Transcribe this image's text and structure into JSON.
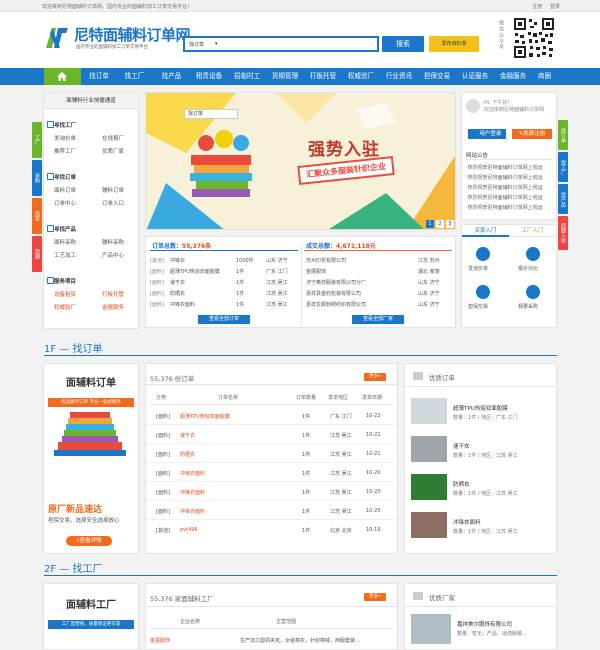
{
  "topbar": {
    "welcome": "欢迎来到尼特面辅料订单网，国内专业的面辅料加工订单交易平台！",
    "register": "注册",
    "login": "登录"
  },
  "header": {
    "logo_title": "尼特面辅料订单网",
    "logo_sub": "国内专业的面辅料加工订单交易平台",
    "search_value": "找订单",
    "search_button": "搜索",
    "publish_button": "发布询价单",
    "wechat_label": "微信公众号"
  },
  "nav": {
    "items": [
      "找订单",
      "找工厂",
      "找产品",
      "租赁设备",
      "招临时工",
      "货期管理",
      "打板托管",
      "权威验厂",
      "行业资讯",
      "担保交易",
      "认证服务",
      "金融服务",
      "商圈"
    ]
  },
  "quick": {
    "title": "面辅料行业快捷通道",
    "groups": [
      {
        "title": "寻找工厂",
        "links": [
          "发询价单",
          "在线报厂",
          "推荐工厂",
          "优质厂家"
        ]
      },
      {
        "title": "寻找订单",
        "links": [
          "面料订单",
          "辅料订单",
          "订单中心",
          "订单入口"
        ]
      },
      {
        "title": "寻找产品",
        "links": [
          "面料采购",
          "辅料采购",
          "工艺加工",
          "产品中心"
        ]
      },
      {
        "title": "服务项目",
        "links": [
          "设备租赁",
          "打板托管",
          "权威验厂",
          "金融服务"
        ]
      }
    ],
    "side_tabs": [
      "工厂",
      "采购",
      "商家",
      "商圈"
    ]
  },
  "banner": {
    "headline": "强势入驻",
    "sub": "汇聚众多服装针织企业",
    "search_text": "找订单",
    "dots": [
      "1",
      "2",
      "3"
    ]
  },
  "stats": {
    "orders_label": "订单总数：",
    "orders_value": "55,376条",
    "deals_label": "成交总额：",
    "deals_value": "4,671,118元",
    "left_rows": [
      [
        "[其他]",
        "冲锋衣",
        "1000件",
        "山东 济宁"
      ],
      [
        "[面料]",
        "超薄TPU热熔双面胶膜",
        "1件",
        "广东 江门"
      ],
      [
        "[面料]",
        "速干衣",
        "1件",
        "江苏 吴江"
      ],
      [
        "[面料]",
        "防晒衣",
        "1件",
        "江苏 吴江"
      ],
      [
        "[面料]",
        "冲锋衣面料",
        "1件",
        "江苏 吴江"
      ]
    ],
    "right_rows": [
      [
        "苏州印花有限公司",
        "江苏 苏州"
      ],
      [
        "金展服饰",
        "湖北 孝感"
      ],
      [
        "济宁奥祥服装有限公司分厂",
        "山东 济宁"
      ],
      [
        "嘉祥县盛钧包装有限公司",
        "山东 济宁"
      ],
      [
        "嘉祥龙顺刺绣纺织有限公司",
        "山东 济宁"
      ]
    ],
    "left_btn": "查看全部订单",
    "right_btn": "查看全部厂家"
  },
  "user": {
    "hello": "Hi, 下午好！",
    "welcome": "欢迎来到尼特面辅料订单网",
    "login_btn": "用户登录",
    "register_btn": "免费注册",
    "notice_title": "网站公告",
    "notices": [
      "·热烈祝贺尼特面辅料订单网上线运",
      "·热烈祝贺尼特面辅料订单网上线运",
      "·热烈祝贺尼特面辅料订单网上线运",
      "·热烈祝贺尼特面辅料订单网上线运",
      "·热烈祝贺尼特面辅料订单网上线运"
    ],
    "side_tabs": [
      "找订单",
      "找工厂",
      "找产品",
      "商圈入驻"
    ]
  },
  "rtabs": {
    "tab1": "买家入门",
    "tab2": "工厂入门",
    "items": [
      "发询价单",
      "报价对比",
      "担保交易",
      "我要采购"
    ]
  },
  "section1": {
    "title": "1F — 找订单",
    "promo_title": "面辅料订单",
    "promo_tag": "优品原料订单 专业一站式服务",
    "promo_head": "原厂新品速达",
    "promo_sub": "担保交易，选择安全选择放心",
    "promo_btn": "查看详情",
    "count": "55,376 份订单",
    "more": "更多»",
    "headers": [
      "分类",
      "订单名称",
      "订单数量",
      "发单地区",
      "发单日期"
    ],
    "rows": [
      [
        "[面料]",
        "超薄TPU热熔双面胶膜",
        "1件",
        "广东 江门",
        "10-22"
      ],
      [
        "[面料]",
        "速干衣",
        "1件",
        "江苏 吴江",
        "10-21"
      ],
      [
        "[面料]",
        "防晒衣",
        "1件",
        "江苏 吴江",
        "10-21"
      ],
      [
        "[面料]",
        "冲锋衣面料",
        "1件",
        "江苏 吴江",
        "10-20"
      ],
      [
        "[面料]",
        "冲锋衣面料",
        "1件",
        "江苏 吴江",
        "10-20"
      ],
      [
        "[面料]",
        "冲锋衣面料",
        "1件",
        "江苏 吴江",
        "10-20"
      ],
      [
        "[其他]",
        "pvt496",
        "1件",
        "北京 北京",
        "10-19"
      ]
    ],
    "quality_title": "优质订单",
    "quality": [
      {
        "name": "超薄TPU热熔双面胶膜",
        "info": "数量：1件 / 地区：广东 江门"
      },
      {
        "name": "速干衣",
        "info": "数量：1件 / 地区：江苏 吴江"
      },
      {
        "name": "防晒衣",
        "info": "数量：1件 / 地区：江苏 吴江"
      },
      {
        "name": "冲锋衣面料",
        "info": "数量：1件 / 地区：江苏 吴江"
      }
    ]
  },
  "section2": {
    "title": "2F — 找工厂",
    "promo_title": "面辅料工厂",
    "promo_tag": "工厂直营快，质量保证更可靠",
    "count": "55,376 家面辅料工厂",
    "more": "更多»",
    "headers": [
      "企业名称",
      "主营范围"
    ],
    "rows": [
      [
        "金展服饰",
        "生产加工圆领夹克，女装棉衣，针织棉绒，西服套装..."
      ]
    ],
    "quality_title": "优质厂家",
    "quality": [
      {
        "name": "嘉祥美尔服饰有限公司",
        "info": "数量：暂无，产品：运动服装..."
      }
    ]
  },
  "colors": {
    "brand_blue": "#1a76c8",
    "green": "#6bb52b",
    "yellow": "#f2c21b",
    "orange": "#f26a1b",
    "red_link": "#e24a1c"
  }
}
